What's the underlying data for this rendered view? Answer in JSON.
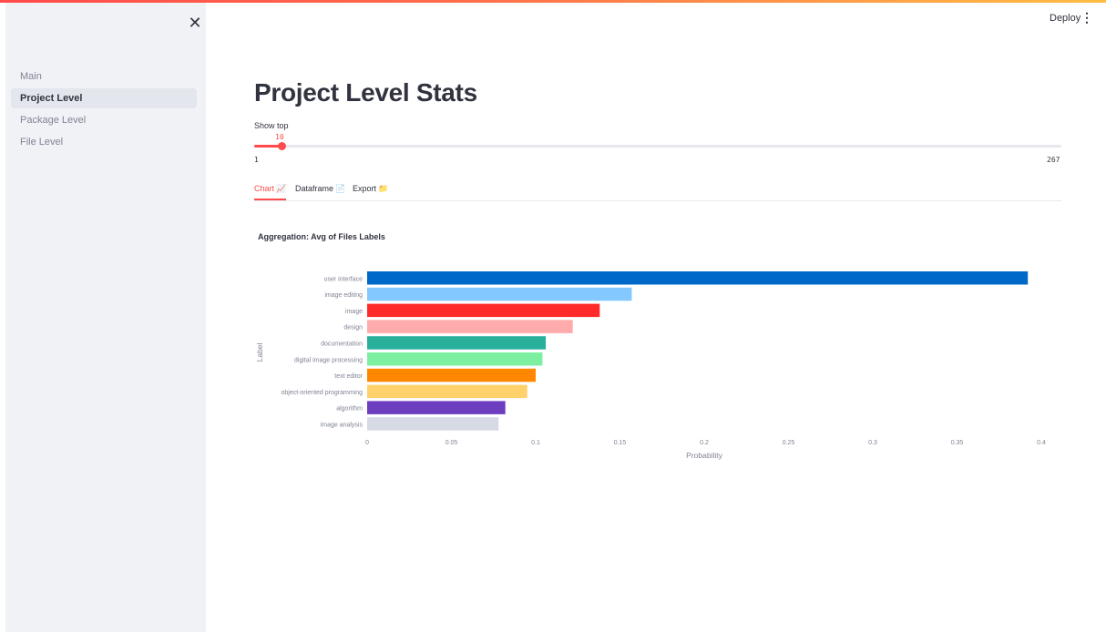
{
  "sidebar": {
    "items": [
      {
        "label": "Main"
      },
      {
        "label": "Project Level"
      },
      {
        "label": "Package Level"
      },
      {
        "label": "File Level"
      }
    ],
    "active_index": 1
  },
  "header": {
    "deploy_label": "Deploy"
  },
  "main": {
    "title": "Project Level Stats",
    "slider": {
      "label": "Show top",
      "value": 10,
      "min": 1,
      "max": 267,
      "fraction": 0.034
    },
    "tabs": [
      {
        "label": "Chart",
        "icon": "📈",
        "icon_name": "chart-icon"
      },
      {
        "label": "Dataframe",
        "icon": "📄",
        "icon_name": "page-icon"
      },
      {
        "label": "Export",
        "icon": "📁",
        "icon_name": "folder-icon"
      }
    ],
    "active_tab": 0
  },
  "chart_data": {
    "type": "bar",
    "orientation": "horizontal",
    "title": "Aggregation: Avg of Files Labels",
    "xlabel": "Probability",
    "ylabel": "Label",
    "xlim": [
      0,
      0.4
    ],
    "x_ticks": [
      "0",
      "0.05",
      "0.1",
      "0.15",
      "0.2",
      "0.25",
      "0.3",
      "0.35",
      "0.4"
    ],
    "categories": [
      "user interface",
      "image editing",
      "image",
      "design",
      "documentation",
      "digital image processing",
      "text editor",
      "object-oriented programming",
      "algorithm",
      "image analysis"
    ],
    "values": [
      0.392,
      0.157,
      0.138,
      0.122,
      0.106,
      0.104,
      0.1,
      0.095,
      0.082,
      0.078
    ],
    "colors": [
      "#0068c9",
      "#83c9ff",
      "#ff2b2b",
      "#ffabab",
      "#29b09d",
      "#7defa1",
      "#ff8700",
      "#ffd16a",
      "#6d3fc0",
      "#d5dae5"
    ],
    "grid": false,
    "legend": "none"
  },
  "colors": {
    "accent": "#ff4b4b",
    "sidebar_bg": "#f0f2f6",
    "text": "#31333f"
  }
}
